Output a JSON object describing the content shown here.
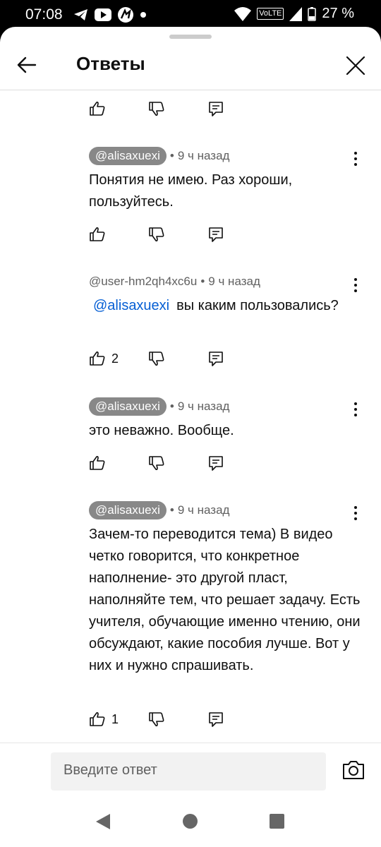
{
  "status_bar": {
    "time": "07:08",
    "battery": "27 %",
    "volte": "VoLTE"
  },
  "header": {
    "title": "Ответы"
  },
  "comments": [
    {
      "id": "c0",
      "partial": true,
      "likes": ""
    },
    {
      "id": "c1",
      "author": "@alisaxuexi",
      "author_highlight": true,
      "time": "9 ч назад",
      "text": "Понятия не имею. Раз хороши, пользуйтесь.",
      "likes": ""
    },
    {
      "id": "c2",
      "author": "@user-hm2qh4xc6u",
      "author_highlight": false,
      "time": "9 ч назад",
      "mention": "@alisaxuexi",
      "text": "вы каким пользовались?",
      "likes": "2"
    },
    {
      "id": "c3",
      "author": "@alisaxuexi",
      "author_highlight": true,
      "time": "9 ч назад",
      "text": "это неважно. Вообще.",
      "likes": ""
    },
    {
      "id": "c4",
      "author": "@alisaxuexi",
      "author_highlight": true,
      "time": "9 ч назад",
      "text": "Зачем-то переводится тема) В видео четко говорится, что конкретное наполнение- это другой пласт, наполняйте тем, что решает задачу. Есть учителя, обучающие именно чтению, они обсуждают, какие пособия лучше. Вот у них и нужно спрашивать.",
      "likes": "1"
    }
  ],
  "footer": {
    "input_placeholder": "Введите ответ"
  },
  "icons": [
    "back-arrow-icon",
    "close-icon",
    "thumbs-up-icon",
    "thumbs-down-icon",
    "reply-icon",
    "more-vert-icon",
    "camera-icon"
  ]
}
